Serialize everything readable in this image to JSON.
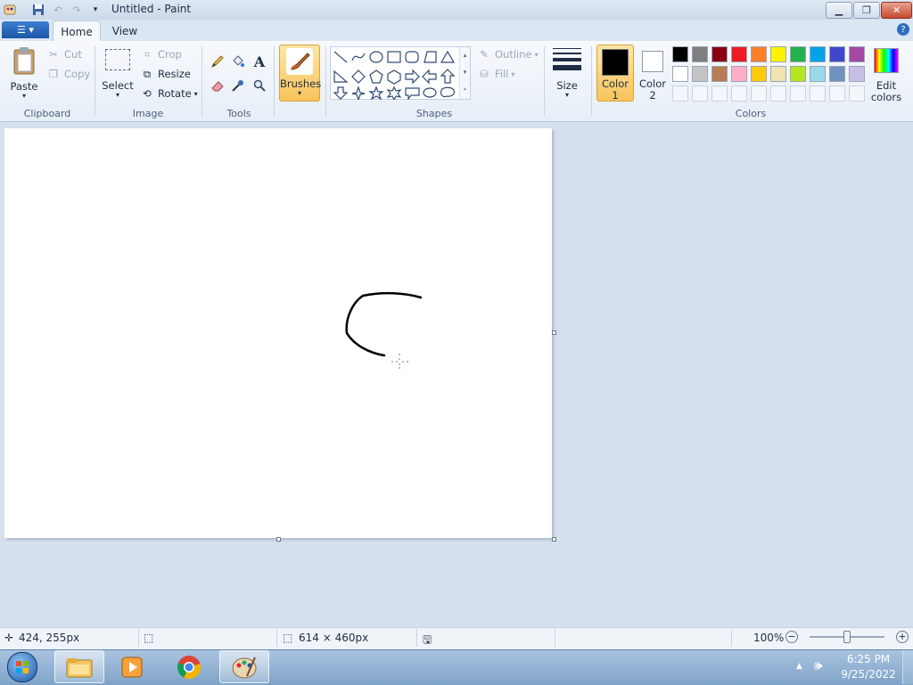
{
  "window": {
    "title": "Untitled - Paint"
  },
  "titlebar_icons": {
    "minimize": "minimize-icon",
    "restore": "restore-icon",
    "close": "close-icon"
  },
  "tabs": [
    {
      "label": "Home"
    },
    {
      "label": "View"
    }
  ],
  "clipboard": {
    "paste": "Paste",
    "cut": "Cut",
    "copy": "Copy",
    "group": "Clipboard"
  },
  "image": {
    "select": "Select",
    "crop": "Crop",
    "resize": "Resize",
    "rotate": "Rotate",
    "group": "Image"
  },
  "tools": {
    "group": "Tools"
  },
  "brushes": {
    "label": "Brushes"
  },
  "shapes": {
    "outline": "Outline",
    "fill": "Fill",
    "group": "Shapes"
  },
  "size": {
    "label": "Size"
  },
  "colors": {
    "color1_label": "Color",
    "color1_num": "1",
    "color2_label": "Color",
    "color2_num": "2",
    "edit_line1": "Edit",
    "edit_line2": "colors",
    "group": "Colors",
    "color1": "#000000",
    "color2": "#ffffff",
    "palette_row1": [
      "#000000",
      "#7f7f7f",
      "#880015",
      "#ed1c24",
      "#ff7f27",
      "#fff200",
      "#22b14c",
      "#00a2e8",
      "#3f48cc",
      "#a349a4"
    ],
    "palette_row2": [
      "#ffffff",
      "#c3c3c3",
      "#b97a57",
      "#ffaec9",
      "#ffc90e",
      "#efe4b0",
      "#b5e61d",
      "#99d9ea",
      "#7092be",
      "#c8bfe7"
    ]
  },
  "status": {
    "cursor_pos": "424, 255px",
    "canvas_size": "614 × 460px",
    "zoom": "100%",
    "zoom_fraction": 0.5
  },
  "taskbar": {
    "time": "6:25 PM",
    "date": "9/25/2022"
  }
}
